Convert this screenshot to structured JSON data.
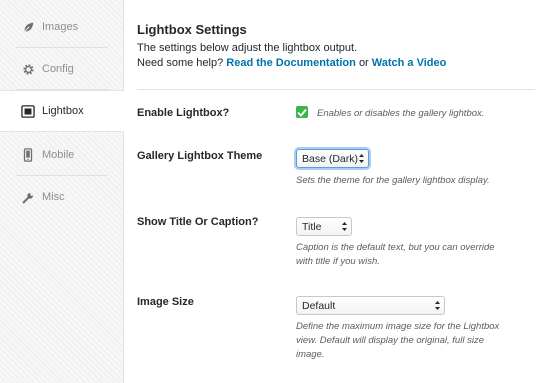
{
  "sidebar": {
    "items": [
      {
        "label": "Images",
        "icon": "leaf-icon"
      },
      {
        "label": "Config",
        "icon": "gear-icon"
      },
      {
        "label": "Lightbox",
        "icon": "lightbox-icon"
      },
      {
        "label": "Mobile",
        "icon": "mobile-icon"
      },
      {
        "label": "Misc",
        "icon": "wrench-icon"
      }
    ],
    "active": "Lightbox"
  },
  "main": {
    "title": "Lightbox Settings",
    "desc_line1": "The settings below adjust the lightbox output.",
    "desc_line2_prefix": "Need some help?",
    "doc_link": "Read the Documentation",
    "desc_or": "or",
    "video_link": "Watch a Video",
    "settings": {
      "enable": {
        "label": "Enable Lightbox?",
        "checked": true,
        "help": "Enables or disables the gallery lightbox."
      },
      "theme": {
        "label": "Gallery Lightbox Theme",
        "value": "Base (Dark)",
        "help": "Sets the theme for the gallery lightbox display."
      },
      "caption": {
        "label": "Show Title Or Caption?",
        "value": "Title",
        "help_line1": "Caption is the default text, but you can override",
        "help_line2": "with title if you wish."
      },
      "size": {
        "label": "Image Size",
        "value": "Default",
        "help_line1": "Define the maximum image size for the Lightbox",
        "help_line2": "view. Default will display the original, full size",
        "help_line3": "image."
      }
    }
  },
  "colors": {
    "link": "#0073aa",
    "check": "#3cb54a",
    "focus": "#5b9dd9"
  }
}
